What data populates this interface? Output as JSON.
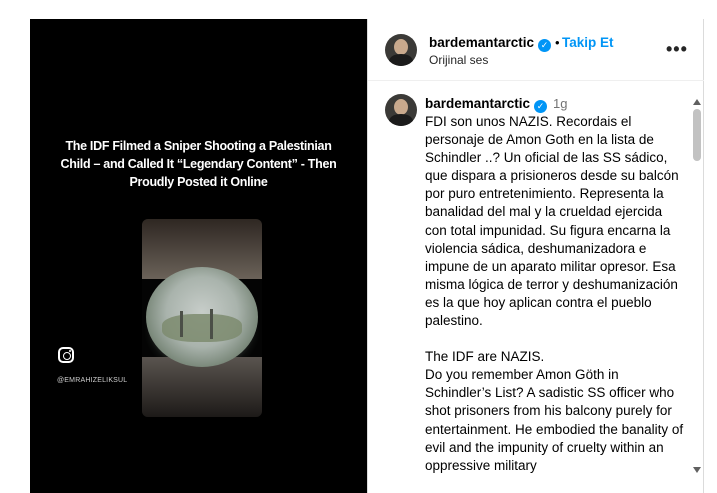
{
  "media": {
    "caption_line1": "The IDF Filmed a Sniper Shooting a Palestinian",
    "caption_line2": "Child – and Called It “Legendary Content” - Then",
    "caption_line3": "Proudly Posted it Online",
    "watermark_icon": "instagram-icon",
    "watermark_handle": "@EMRAHIZELIKSUL"
  },
  "header": {
    "username": "bardemantarctic",
    "verified_icon": "verified-badge-icon",
    "separator": "•",
    "follow_label": "Takip Et",
    "subtitle": "Orijinal ses",
    "more_icon": "more-options-icon"
  },
  "comment": {
    "username": "bardemantarctic",
    "time": "1g",
    "paragraphs": [
      "FDI son unos NAZIS. Recordais el personaje de Amon Goth en la lista de Schindler ..? Un oficial de las SS sádico, que dispara a prisioneros desde su balcón por puro entretenimiento. Representa la banalidad del mal y la crueldad ejercida con total impunidad. Su figura encarna la violencia sádica, deshumanizadora e impune de un aparato militar opresor. Esa misma lógica de terror y deshumanización es la que hoy aplican contra el pueblo palestino.",
      "The IDF are NAZIS.",
      "Do you remember Amon Göth in Schindler’s List? A sadistic SS officer who shot prisoners from his balcony purely for entertainment. He embodied the banality of evil and the impunity of cruelty within an oppressive military"
    ]
  },
  "colors": {
    "accent": "#0095f6",
    "media_bg": "#000000",
    "muted_text": "#737373"
  }
}
